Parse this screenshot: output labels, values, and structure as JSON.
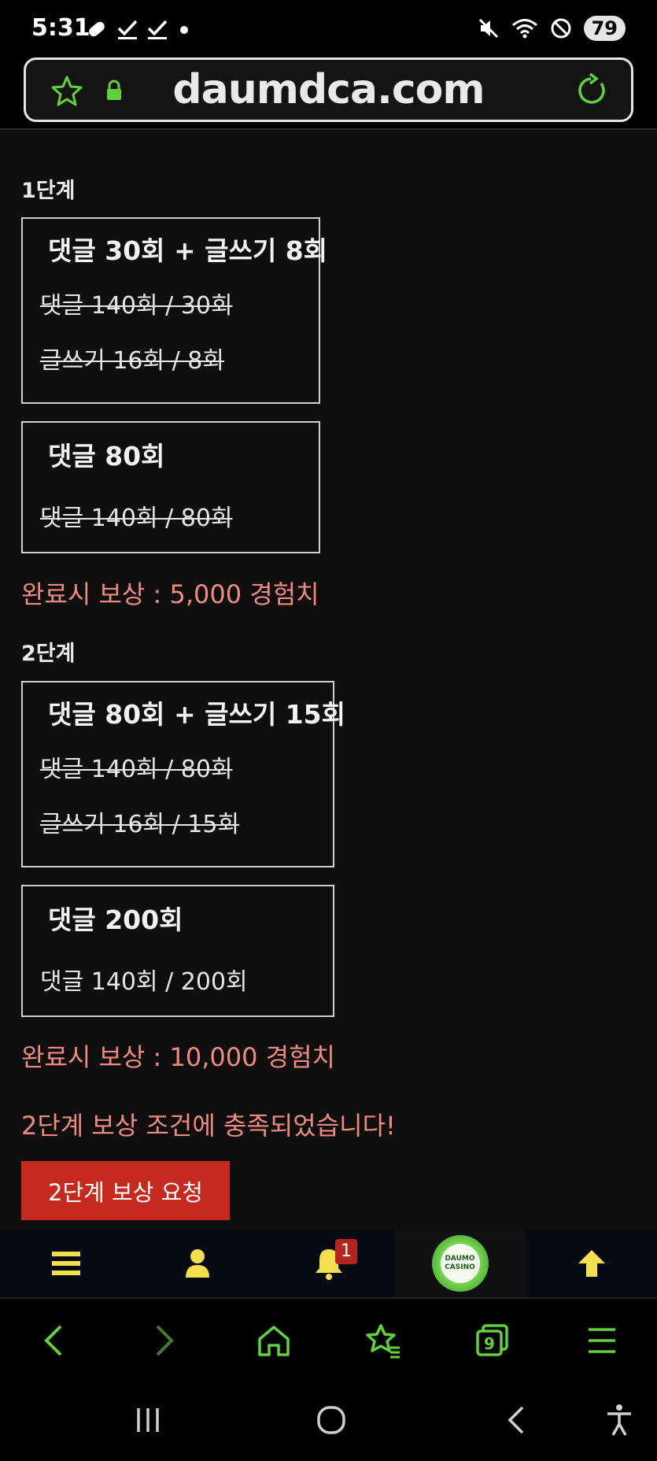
{
  "status_bar": {
    "time": "5:31",
    "battery": "79"
  },
  "browser": {
    "url": "daumdca.com"
  },
  "stage1": {
    "title": "1단계",
    "box1": {
      "title": "댓글 30회 + 글쓰기 8회",
      "line1": "댓글 140회 / 30회",
      "line2": "글쓰기 16회 / 8회"
    },
    "box2": {
      "title": "댓글 80회",
      "line1": "댓글 140회 / 80회"
    },
    "reward": "완료시 보상 : 5,000 경험치"
  },
  "stage2": {
    "title": "2단계",
    "box1": {
      "title": "댓글 80회 + 글쓰기 15회",
      "line1": "댓글 140회 / 80회",
      "line2": "글쓰기 16회 / 15회"
    },
    "box2": {
      "title": "댓글 200회",
      "line1": "댓글 140회 / 200회"
    },
    "reward": "완료시 보상 : 10,000 경험치"
  },
  "notice": "2단계 보상 조건에 충족되었습니다!",
  "claim_button": "2단계 보상 요청",
  "site_nav": {
    "notification_count": "1",
    "logo_text_top": "DAUMO",
    "logo_text_bottom": "CASINO"
  },
  "browser_bar": {
    "tab_count": "9"
  },
  "colors": {
    "accent_green": "#5fd13a",
    "nav_yellow": "#f4e04d",
    "reward_text": "#f08a7e",
    "claim_button": "#c62a1e"
  }
}
